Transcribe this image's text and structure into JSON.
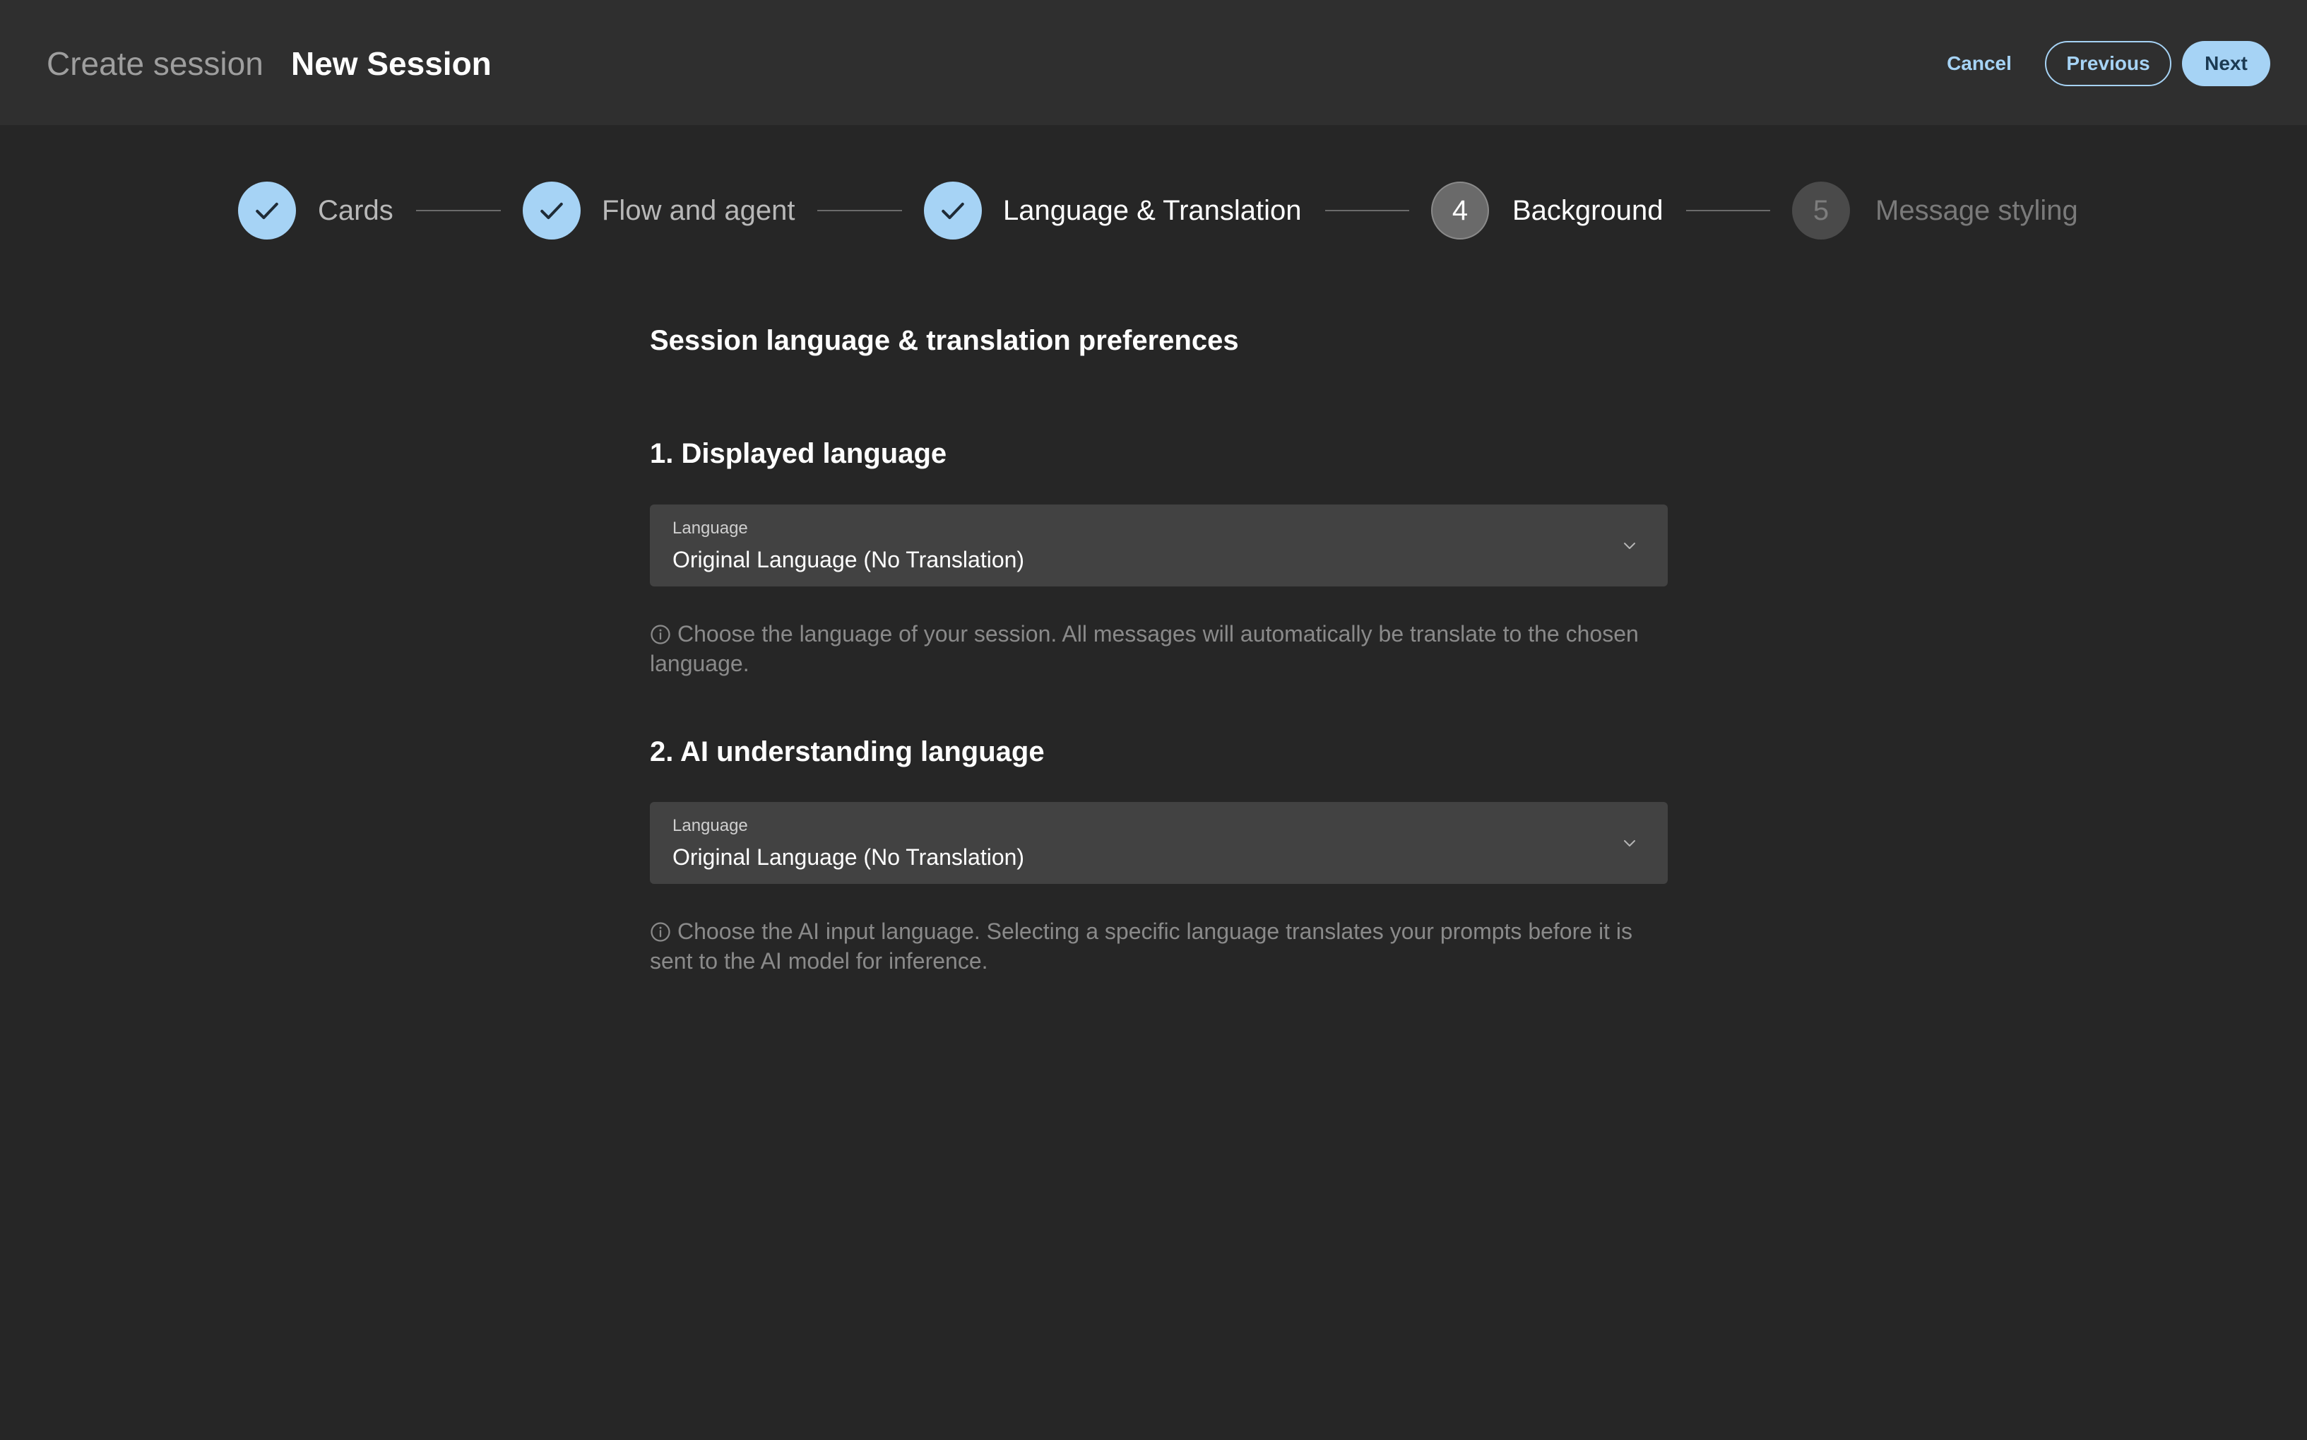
{
  "header": {
    "parent": "Create session",
    "current": "New Session",
    "cancel_label": "Cancel",
    "previous_label": "Previous",
    "next_label": "Next"
  },
  "stepper": {
    "steps": [
      {
        "label": "Cards",
        "status": "completed",
        "icon": "check-icon"
      },
      {
        "label": "Flow and agent",
        "status": "completed",
        "icon": "check-icon"
      },
      {
        "label": "Language & Translation",
        "status": "current",
        "icon": "check-icon"
      },
      {
        "number": "4",
        "label": "Background",
        "status": "upcoming"
      },
      {
        "number": "5",
        "label": "Message styling",
        "status": "upcoming"
      }
    ]
  },
  "main": {
    "title": "Session language & translation preferences",
    "sections": [
      {
        "heading": "1. Displayed language",
        "select_label": "Language",
        "select_value": "Original Language (No Translation)",
        "helper": "Choose the language of your session. All messages will automatically be translate to the chosen language."
      },
      {
        "heading": "2. AI understanding language",
        "select_label": "Language",
        "select_value": "Original Language (No Translation)",
        "helper": "Choose the AI input language. Selecting a specific language translates your prompts before it is sent to the AI model for inference."
      }
    ]
  },
  "colors": {
    "background": "#262626",
    "header_background": "#2f2f2f",
    "accent": "#a6d3f5",
    "field_background": "#424242",
    "helper_text": "#8a8a8a"
  }
}
